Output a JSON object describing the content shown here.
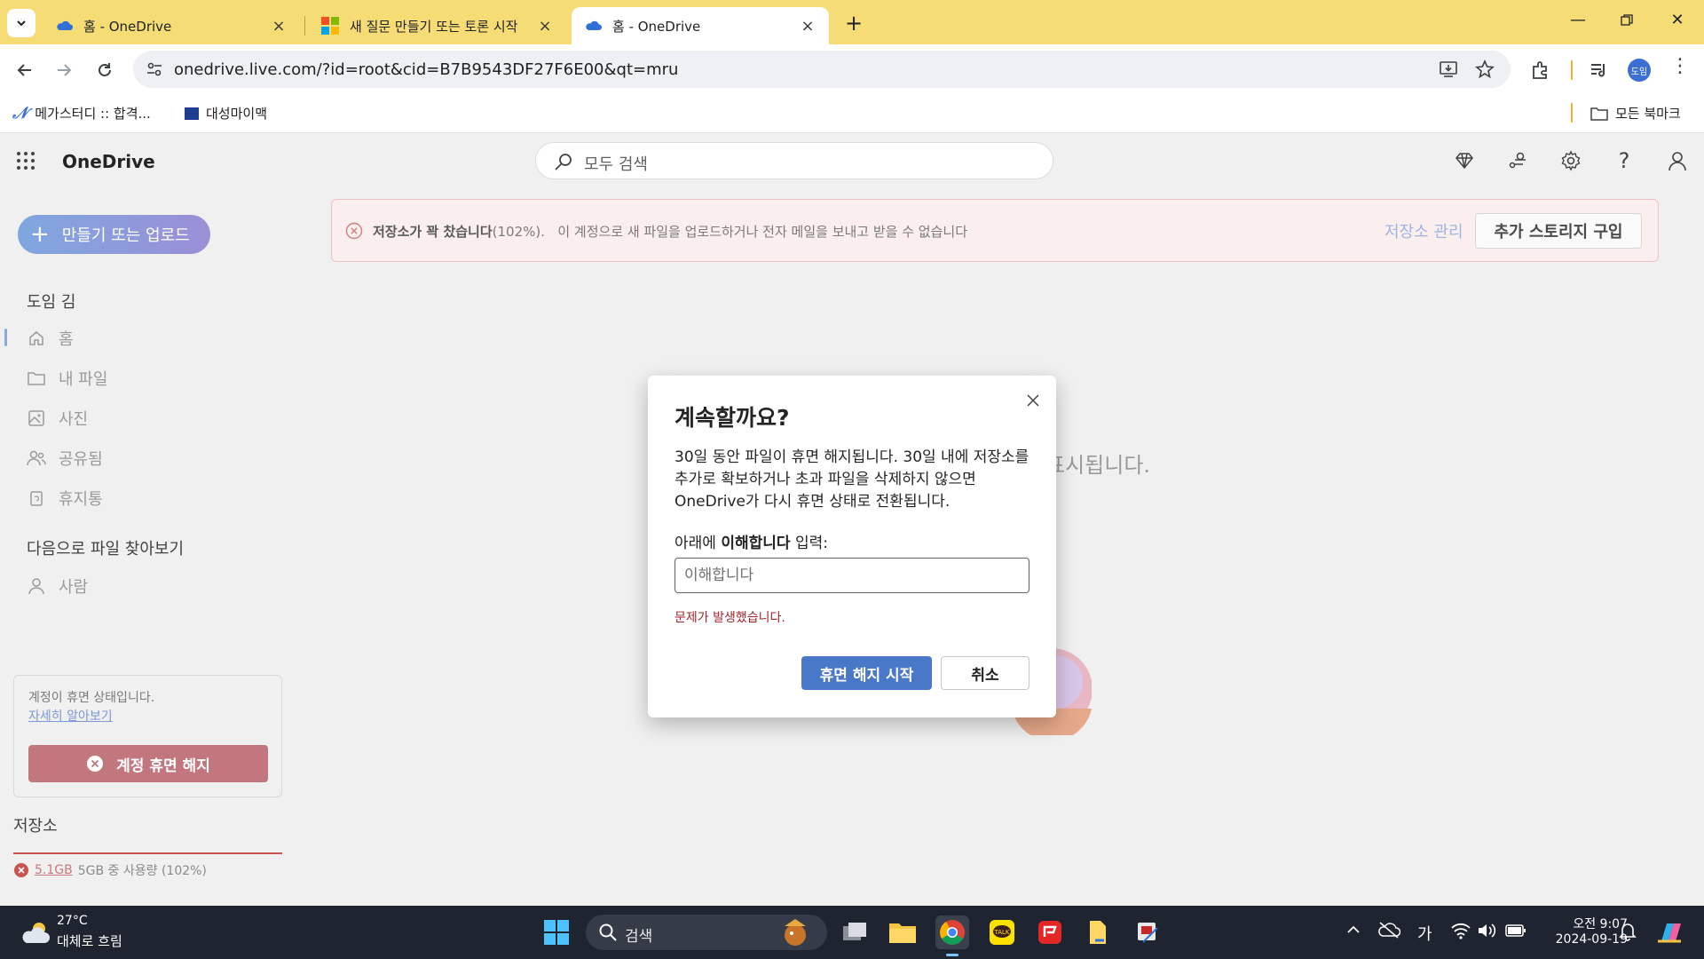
{
  "browser": {
    "tabs": [
      {
        "title": "홈 - OneDrive",
        "active": false
      },
      {
        "title": "새 질문 만들기 또는 토론 시작",
        "active": false
      },
      {
        "title": "홈 - OneDrive",
        "active": true
      }
    ],
    "url": "onedrive.live.com/?id=root&cid=B7B9543DF27F6E00&qt=mru",
    "profile_initials": "도임",
    "bookmarks": [
      {
        "label": "메가스터디 :: 합격..."
      },
      {
        "label": "대성마이맥"
      }
    ],
    "all_bookmarks_label": "모든 북마크"
  },
  "app": {
    "name": "OneDrive",
    "search_placeholder": "모두 검색"
  },
  "sidebar": {
    "create_button_label": "만들기 또는 업로드",
    "user_name": "도임 김",
    "nav_items": [
      {
        "label": "홈",
        "icon": "home-icon",
        "selected": true
      },
      {
        "label": "내 파일",
        "icon": "folder-icon",
        "selected": false
      },
      {
        "label": "사진",
        "icon": "photo-icon",
        "selected": false
      },
      {
        "label": "공유됨",
        "icon": "people-icon",
        "selected": false
      },
      {
        "label": "휴지통",
        "icon": "recycle-bin-icon",
        "selected": false
      }
    ],
    "browse_section_title": "다음으로 파일 찾아보기",
    "browse_items": [
      {
        "label": "사람",
        "icon": "person-icon"
      }
    ],
    "frozen_card": {
      "message": "계정이 휴면 상태입니다.",
      "link_label": "자세히 알아보기",
      "button_label": "계정 휴면 해지"
    },
    "storage": {
      "title": "저장소",
      "used": "5.1GB",
      "usage_text": "5GB 중 사용량 (102%)",
      "percent": 102
    }
  },
  "banner": {
    "title": "저장소가 꽉 찼습니다",
    "percent_text": "(102%).",
    "message": "이 계정으로 새 파일을 업로드하거나 전자 메일을 보내고 받을 수 없습니다",
    "manage_label": "저장소 관리",
    "buy_label": "추가 스토리지 구입"
  },
  "background_message_fragment": "표시됩니다.",
  "dialog": {
    "title": "계속할까요?",
    "body": "30일 동안 파일이 휴면 해지됩니다. 30일 내에 저장소를 추가로 확보하거나 초과 파일을 삭제하지 않으면 OneDrive가 다시 휴면 상태로 전환됩니다.",
    "label_prefix": "아래에",
    "label_keyword": "이해합니다",
    "label_suffix": "입력:",
    "input_placeholder": "이해합니다",
    "input_value": "",
    "error_text": "문제가 발생했습니다.",
    "primary_label": "휴면 해지 시작",
    "cancel_label": "취소"
  },
  "taskbar": {
    "weather_temp": "27°C",
    "weather_desc": "대체로 흐림",
    "search_placeholder": "검색",
    "ime_label": "가",
    "time": "오전 9:07",
    "date": "2024-09-19"
  },
  "colors": {
    "tabbar": "#f5dc75",
    "primary_button": "#4a78c9",
    "error": "#a4262c",
    "unfreeze_button": "#c2767e"
  }
}
